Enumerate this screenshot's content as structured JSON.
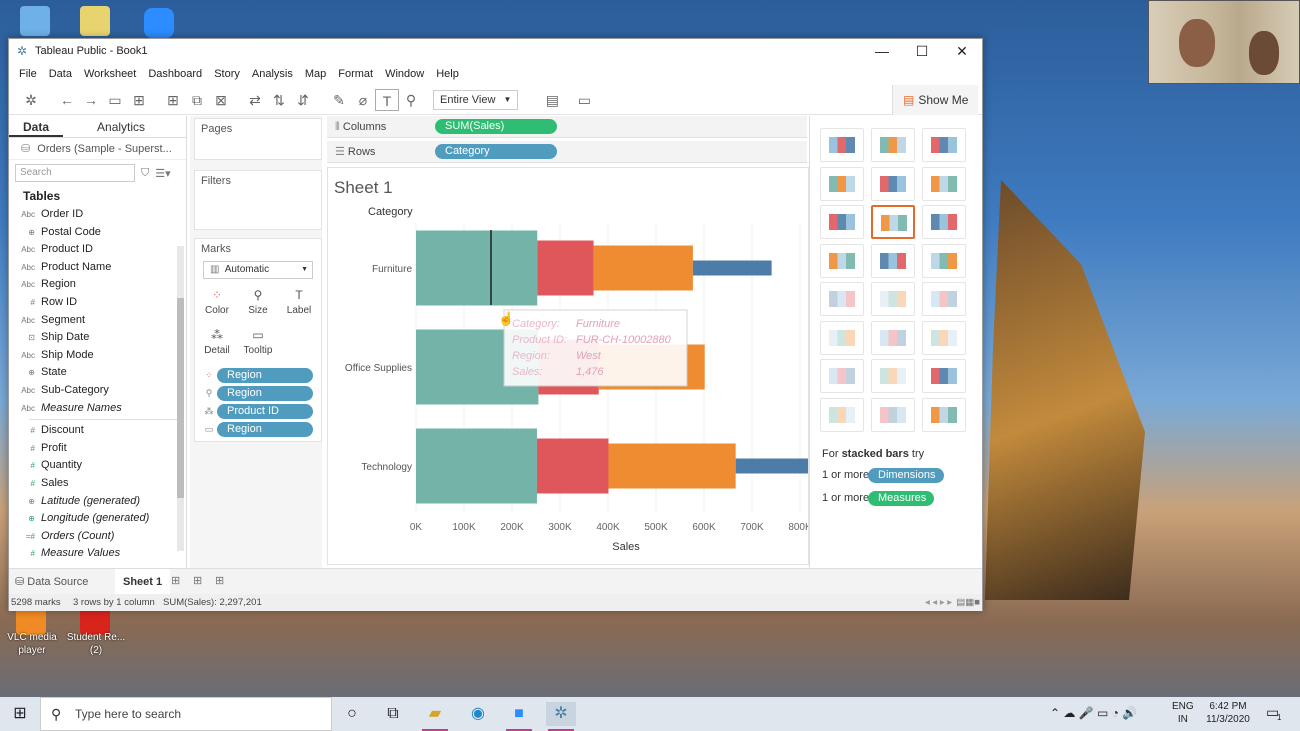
{
  "window": {
    "title": "Tableau Public - Book1"
  },
  "menu": [
    "File",
    "Data",
    "Worksheet",
    "Dashboard",
    "Story",
    "Analysis",
    "Map",
    "Format",
    "Window",
    "Help"
  ],
  "toolbar": {
    "view_mode": "Entire View",
    "show_me": "Show Me"
  },
  "data_pane": {
    "tabs": [
      "Data",
      "Analytics"
    ],
    "datasource": "Orders (Sample - Superst...",
    "search_placeholder": "Search",
    "tables_heading": "Tables",
    "dimensions": [
      {
        "type": "Abc",
        "name": "Order ID"
      },
      {
        "type": "⊕",
        "name": "Postal Code"
      },
      {
        "type": "Abc",
        "name": "Product ID"
      },
      {
        "type": "Abc",
        "name": "Product Name"
      },
      {
        "type": "Abc",
        "name": "Region"
      },
      {
        "type": "#",
        "name": "Row ID"
      },
      {
        "type": "Abc",
        "name": "Segment"
      },
      {
        "type": "⊡",
        "name": "Ship Date"
      },
      {
        "type": "Abc",
        "name": "Ship Mode"
      },
      {
        "type": "⊕",
        "name": "State"
      },
      {
        "type": "Abc",
        "name": "Sub-Category"
      },
      {
        "type": "Abc",
        "name": "Measure Names",
        "italic": true
      }
    ],
    "measures": [
      {
        "type": "#",
        "name": "Discount"
      },
      {
        "type": "#",
        "name": "Profit"
      },
      {
        "type": "#",
        "name": "Quantity"
      },
      {
        "type": "#",
        "name": "Sales"
      },
      {
        "type": "⊕",
        "name": "Latitude (generated)",
        "italic": true
      },
      {
        "type": "⊕",
        "name": "Longitude (generated)",
        "italic": true
      },
      {
        "type": "=#",
        "name": "Orders (Count)",
        "italic": true
      },
      {
        "type": "#",
        "name": "Measure Values",
        "italic": true
      }
    ]
  },
  "cards": {
    "pages": "Pages",
    "filters": "Filters",
    "marks": "Marks",
    "mark_type": "Automatic",
    "mark_buttons": [
      "Color",
      "Size",
      "Label",
      "Detail",
      "Tooltip"
    ],
    "mark_pills": [
      "Region",
      "Region",
      "Product ID",
      "Region"
    ]
  },
  "shelves": {
    "columns_label": "Columns",
    "columns_pill": "SUM(Sales)",
    "rows_label": "Rows",
    "rows_pill": "Category"
  },
  "sheet": {
    "title": "Sheet 1",
    "row_header": "Category"
  },
  "chart_data": {
    "type": "bar",
    "stacked": true,
    "categories": [
      "Furniture",
      "Office Supplies",
      "Technology"
    ],
    "xlabel": "Sales",
    "ylabel": "Category",
    "x_ticks": [
      "0K",
      "100K",
      "200K",
      "300K",
      "400K",
      "500K",
      "600K",
      "700K",
      "800K"
    ],
    "xlim": [
      0,
      820000
    ],
    "series": [
      {
        "color": "#73b3a8",
        "values": [
          252612,
          255000,
          252000
        ]
      },
      {
        "color": "#e0575b",
        "values": [
          117299,
          125651,
          149000
        ]
      },
      {
        "color": "#ef8c32",
        "values": [
          206966,
          220853,
          264974
        ]
      },
      {
        "color": "#4e7ca8",
        "values": [
          164000,
          0,
          270000
        ]
      }
    ],
    "tooltip": {
      "rows": [
        {
          "label": "Category:",
          "value": "Furniture"
        },
        {
          "label": "Product ID:",
          "value": "FUR-CH-10002880"
        },
        {
          "label": "Region:",
          "value": "West"
        },
        {
          "label": "Sales:",
          "value": "1,476"
        }
      ]
    }
  },
  "show_me": {
    "hint_prefix": "For",
    "hint_chart": "stacked bars",
    "hint_suffix": "try",
    "req1": "1 or more",
    "req1_pill": "Dimensions",
    "req2": "1 or more",
    "req2_pill": "Measures"
  },
  "bottom_tabs": {
    "data_source": "Data Source",
    "sheet": "Sheet 1"
  },
  "status": {
    "marks": "5298 marks",
    "dims": "3 rows by 1 column",
    "sum": "SUM(Sales): 2,297,201"
  },
  "desktop_icons": [
    {
      "label": "VLC media player"
    },
    {
      "label": "Student Re... (2)"
    }
  ],
  "taskbar": {
    "search_placeholder": "Type here to search",
    "lang1": "ENG",
    "lang2": "IN",
    "time": "6:42 PM",
    "date": "11/3/2020",
    "notif_count": "1"
  }
}
